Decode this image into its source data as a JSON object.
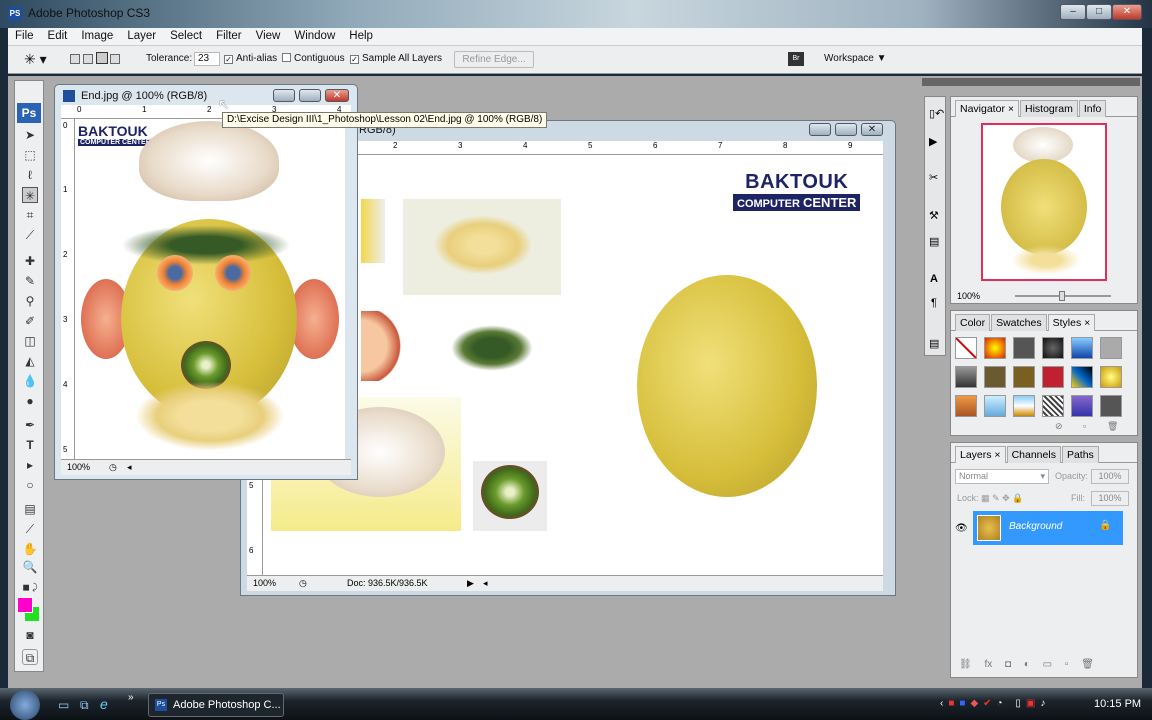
{
  "app": {
    "title": "Adobe Photoshop CS3",
    "icon": "PS"
  },
  "menu": [
    "File",
    "Edit",
    "Image",
    "Layer",
    "Select",
    "Filter",
    "View",
    "Window",
    "Help"
  ],
  "options": {
    "tool_icon": "magic-wand-icon",
    "tolerance_label": "Tolerance:",
    "tolerance_value": "23",
    "anti_alias": {
      "label": "Anti-alias",
      "checked": true
    },
    "contiguous": {
      "label": "Contiguous",
      "checked": false
    },
    "sample_all": {
      "label": "Sample All Layers",
      "checked": true
    },
    "refine_edge": "Refine Edge...",
    "workspace": "Workspace ▼"
  },
  "doc_end": {
    "title": "End.jpg @ 100% (RGB/8)",
    "zoom": "100%",
    "ruler_h": [
      "0",
      "1",
      "2",
      "3",
      "4"
    ],
    "ruler_v": [
      "0",
      "1",
      "2",
      "3",
      "4",
      "5"
    ],
    "brand1": "BAKTOUK",
    "brand2": "COMPUTER CENTER"
  },
  "tooltip": "D:\\Excise Design III\\1_Photoshop\\Lesson 02\\End.jpg @ 100% (RGB/8)",
  "doc2": {
    "title_visible": "RGB/8)",
    "zoom": "100%",
    "doc_info": "Doc: 936.5K/936.5K",
    "ruler_h": [
      "2",
      "3",
      "4",
      "5",
      "6",
      "7",
      "8",
      "9"
    ],
    "ruler_v": [
      "5",
      "6"
    ],
    "brand1": "BAKTOUK",
    "brand2a": "COMPUTER ",
    "brand2b": "CENTER"
  },
  "navigator": {
    "tabs": [
      "Navigator ×",
      "Histogram",
      "Info"
    ],
    "zoom": "100%"
  },
  "styles_panel": {
    "tabs": [
      "Color",
      "Swatches",
      "Styles ×"
    ]
  },
  "layers_panel": {
    "tabs": [
      "Layers ×",
      "Channels",
      "Paths"
    ],
    "blend_mode": "Normal",
    "opacity_label": "Opacity:",
    "opacity": "100%",
    "lock_label": "Lock:",
    "fill_label": "Fill:",
    "fill": "100%",
    "layer_name": "Background"
  },
  "colors": {
    "foreground": "#ff00cc",
    "background": "#22e022",
    "selection": "#3399ff"
  },
  "taskbar": {
    "task": "Adobe Photoshop C...",
    "time": "10:15 PM",
    "chevron": "»"
  }
}
